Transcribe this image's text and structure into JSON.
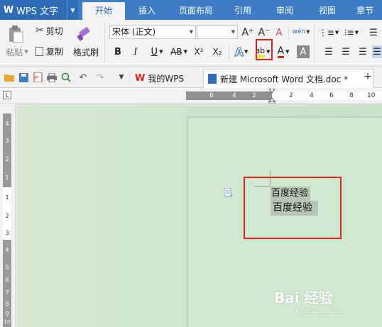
{
  "app": {
    "title": "WPS 文字"
  },
  "tabs": [
    {
      "label": "开始",
      "active": true
    },
    {
      "label": "插入"
    },
    {
      "label": "页面布局"
    },
    {
      "label": "引用"
    },
    {
      "label": "审阅"
    },
    {
      "label": "视图"
    },
    {
      "label": "章节"
    }
  ],
  "ribbon": {
    "paste_label": "粘贴",
    "cut_label": "剪切",
    "copy_label": "复制",
    "format_painter_label": "格式刷",
    "font_name": "宋体 (正文)",
    "font_size": "",
    "grow_font": "A⁺",
    "shrink_font": "A⁻",
    "clear_format": "A",
    "phonetic": "wén",
    "bold": "B",
    "italic": "I",
    "underline": "U",
    "strike": "AB",
    "superscript": "X²",
    "subscript": "X₂",
    "text_effect": "A",
    "highlight": "ab",
    "font_color": "A",
    "char_shading": "A",
    "accent_red": "#e8231c",
    "accent_blue": "#2f6cb8"
  },
  "doc_tabs": [
    {
      "label": "我的WPS"
    },
    {
      "label": "新建 Microsoft Word 文档.doc *",
      "current": true
    }
  ],
  "new_tab": "+",
  "ruler": {
    "h_numbers": [
      "6",
      "4",
      "2",
      "2",
      "4",
      "6",
      "8",
      "10"
    ],
    "v_numbers": [
      "4",
      "3",
      "2",
      "1",
      "1",
      "2",
      "3",
      "4",
      "5",
      "6",
      "7",
      "8",
      "9",
      "10"
    ]
  },
  "document": {
    "line1": "百度经验",
    "line2": "百度经验"
  },
  "watermark": {
    "brand": "Bai 经验",
    "url": "jingyan.baidu.com"
  }
}
